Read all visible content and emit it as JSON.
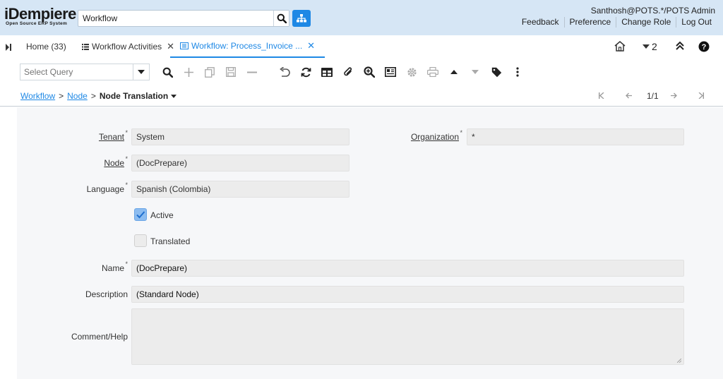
{
  "header": {
    "logo_main": "iDempiere",
    "logo_sub": "Open Source ERP System",
    "search_value": "Workflow",
    "user": "Santhosh@POTS.*/POTS Admin",
    "menu": [
      "Feedback",
      "Preference",
      "Change Role",
      "Log Out"
    ]
  },
  "tabs": [
    {
      "label": "Home (33)"
    },
    {
      "label": "Workflow Activities"
    },
    {
      "label": "Workflow: Process_Invoice ..."
    }
  ],
  "tabbar": {
    "count": "2"
  },
  "toolbar": {
    "query_placeholder": "Select Query"
  },
  "breadcrumb": {
    "workflow": "Workflow",
    "node": "Node",
    "current": "Node Translation",
    "sep": ">"
  },
  "record_nav": {
    "position": "1/1"
  },
  "form": {
    "tenant_label": "Tenant",
    "tenant_value": "System",
    "org_label": "Organization",
    "org_value": "*",
    "node_label": "Node",
    "node_value": "(DocPrepare)",
    "language_label": "Language",
    "language_value": "Spanish (Colombia)",
    "active_label": "Active",
    "active_checked": true,
    "translated_label": "Translated",
    "translated_checked": false,
    "name_label": "Name",
    "name_value": "(DocPrepare)",
    "description_label": "Description",
    "description_value": "(Standard Node)",
    "comment_label": "Comment/Help",
    "comment_value": ""
  },
  "colors": {
    "accent": "#1e88e5",
    "header_bg": "#d6e6f5",
    "form_bg": "#f6f7f9"
  }
}
